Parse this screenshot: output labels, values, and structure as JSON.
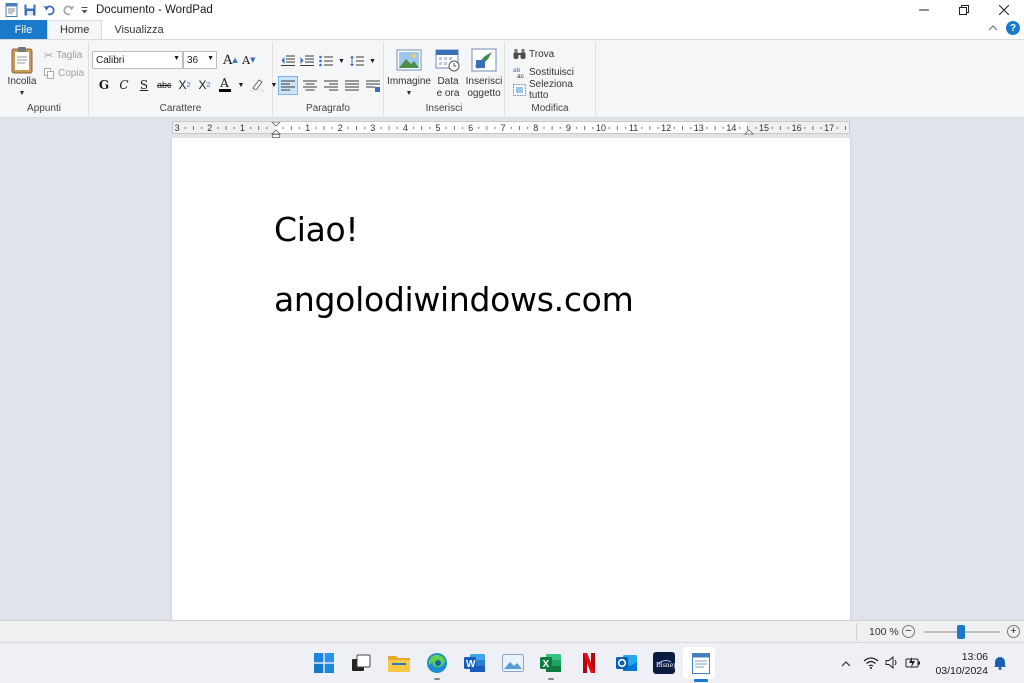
{
  "window": {
    "title": "Documento - WordPad",
    "controls": [
      "minimize",
      "restore",
      "close"
    ]
  },
  "tabs": {
    "file": "File",
    "items": [
      {
        "label": "Home",
        "active": true
      },
      {
        "label": "Visualizza",
        "active": false
      }
    ]
  },
  "ribbon": {
    "clipboard": {
      "label": "Appunti",
      "paste": "Incolla",
      "cut": "Taglia",
      "copy": "Copia"
    },
    "font": {
      "label": "Carattere",
      "family": "Calibri",
      "size": "36",
      "bold": "G",
      "italic": "C",
      "underline": "S",
      "strikethrough": "abc"
    },
    "paragraph": {
      "label": "Paragrafo"
    },
    "insert": {
      "label": "Inserisci",
      "image": "Immagine",
      "datetime_line1": "Data",
      "datetime_line2": "e ora",
      "object_line1": "Inserisci",
      "object_line2": "oggetto"
    },
    "edit": {
      "label": "Modifica",
      "find": "Trova",
      "replace": "Sostituisci",
      "select_all": "Seleziona tutto"
    }
  },
  "ruler": {
    "ticks": [
      "3",
      "2",
      "1",
      "1",
      "2",
      "3",
      "4",
      "5",
      "6",
      "7",
      "8",
      "9",
      "10",
      "11",
      "12",
      "13",
      "14",
      "15",
      "16",
      "17"
    ]
  },
  "document": {
    "lines": [
      "Ciao!",
      "angolodiwindows.com"
    ]
  },
  "status": {
    "zoom": "100 %",
    "zoom_minus": "−",
    "zoom_plus": "+"
  },
  "taskbar": {
    "apps": [
      "start",
      "task-view",
      "file-explorer",
      "edge",
      "word",
      "photos",
      "excel",
      "netflix",
      "outlook",
      "disney-plus",
      "wordpad"
    ],
    "time": "13:06",
    "date": "03/10/2024"
  },
  "colors": {
    "accent": "#1979ca",
    "ribbon_bg": "#f5f6f7",
    "canvas_bg": "#dfe3ea"
  }
}
